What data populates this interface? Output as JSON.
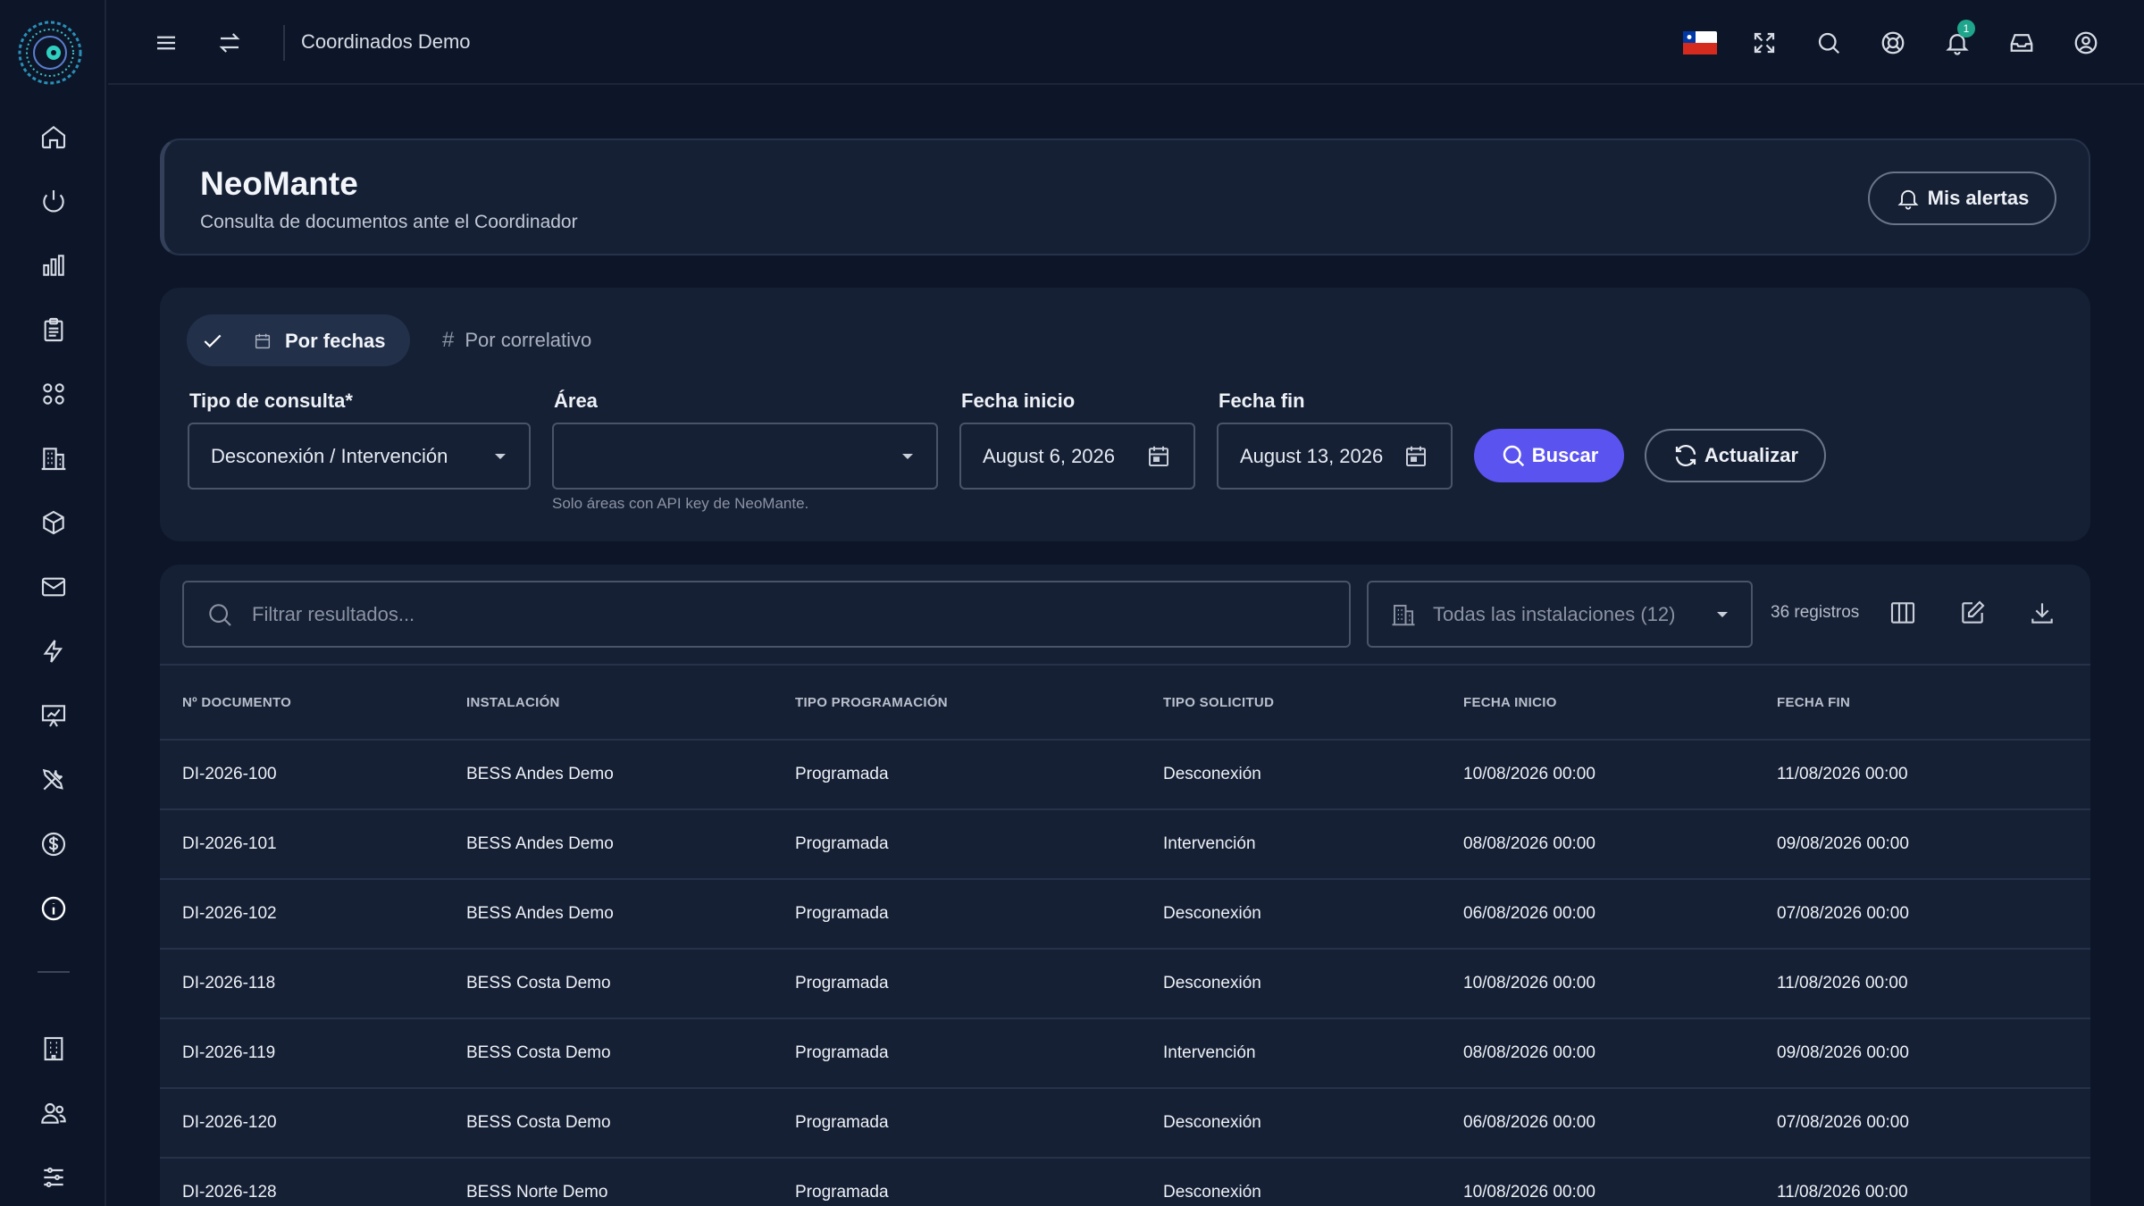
{
  "topbar": {
    "title": "Coordinados Demo",
    "notification_count": "1"
  },
  "header": {
    "title": "NeoMante",
    "subtitle": "Consulta de documentos ante el Coordinador",
    "alerts_label": "Mis alertas"
  },
  "query": {
    "tabs": [
      {
        "label": "Por fechas",
        "active": true
      },
      {
        "label": "Por correlativo",
        "active": false
      }
    ],
    "tipo_label": "Tipo de consulta*",
    "tipo_value": "Desconexión / Intervención",
    "area_label": "Área",
    "area_value": "",
    "area_hint": "Solo áreas con API key de NeoMante.",
    "fecha_inicio_label": "Fecha inicio",
    "fecha_inicio_value": "August 6, 2026",
    "fecha_fin_label": "Fecha fin",
    "fecha_fin_value": "August 13, 2026",
    "search_label": "Buscar",
    "refresh_label": "Actualizar"
  },
  "results": {
    "filter_placeholder": "Filtrar resultados...",
    "installations_label": "Todas las instalaciones (12)",
    "records_label": "36 registros",
    "columns": [
      "Nº DOCUMENTO",
      "INSTALACIÓN",
      "TIPO PROGRAMACIÓN",
      "TIPO SOLICITUD",
      "FECHA INICIO",
      "FECHA FIN"
    ],
    "rows": [
      [
        "DI-2026-100",
        "BESS Andes Demo",
        "Programada",
        "Desconexión",
        "10/08/2026 00:00",
        "11/08/2026 00:00"
      ],
      [
        "DI-2026-101",
        "BESS Andes Demo",
        "Programada",
        "Intervención",
        "08/08/2026 00:00",
        "09/08/2026 00:00"
      ],
      [
        "DI-2026-102",
        "BESS Andes Demo",
        "Programada",
        "Desconexión",
        "06/08/2026 00:00",
        "07/08/2026 00:00"
      ],
      [
        "DI-2026-118",
        "BESS Costa Demo",
        "Programada",
        "Desconexión",
        "10/08/2026 00:00",
        "11/08/2026 00:00"
      ],
      [
        "DI-2026-119",
        "BESS Costa Demo",
        "Programada",
        "Intervención",
        "08/08/2026 00:00",
        "09/08/2026 00:00"
      ],
      [
        "DI-2026-120",
        "BESS Costa Demo",
        "Programada",
        "Desconexión",
        "06/08/2026 00:00",
        "07/08/2026 00:00"
      ],
      [
        "DI-2026-128",
        "BESS Norte Demo",
        "Programada",
        "Desconexión",
        "10/08/2026 00:00",
        "11/08/2026 00:00"
      ]
    ]
  },
  "colors": {
    "background": "#0d1628",
    "card": "#152035",
    "primary": "#5b53f0",
    "badge": "#1fa58b"
  }
}
